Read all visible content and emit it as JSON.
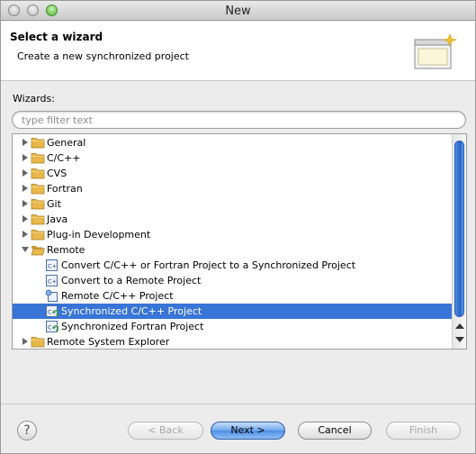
{
  "window": {
    "title": "New"
  },
  "banner": {
    "title": "Select a wizard",
    "description": "Create a new synchronized project"
  },
  "wizards_label": "Wizards:",
  "filter": {
    "placeholder": "type filter text",
    "value": ""
  },
  "tree": {
    "items": [
      {
        "label": "General",
        "kind": "folder",
        "expanded": false,
        "selected": false
      },
      {
        "label": "C/C++",
        "kind": "folder",
        "expanded": false,
        "selected": false
      },
      {
        "label": "CVS",
        "kind": "folder",
        "expanded": false,
        "selected": false
      },
      {
        "label": "Fortran",
        "kind": "folder",
        "expanded": false,
        "selected": false
      },
      {
        "label": "Git",
        "kind": "folder",
        "expanded": false,
        "selected": false
      },
      {
        "label": "Java",
        "kind": "folder",
        "expanded": false,
        "selected": false
      },
      {
        "label": "Plug-in Development",
        "kind": "folder",
        "expanded": false,
        "selected": false
      },
      {
        "label": "Remote",
        "kind": "folder",
        "expanded": true,
        "selected": false
      },
      {
        "label": "Convert C/C++ or Fortran Project to a Synchronized Project",
        "kind": "wizard",
        "icon": "cpp-convert-icon",
        "selected": false
      },
      {
        "label": "Convert to a Remote Project",
        "kind": "wizard",
        "icon": "cpp-convert-icon",
        "selected": false
      },
      {
        "label": "Remote C/C++ Project",
        "kind": "wizard",
        "icon": "remote-project-icon",
        "selected": false
      },
      {
        "label": "Synchronized C/C++ Project",
        "kind": "wizard",
        "icon": "sync-project-icon",
        "selected": true
      },
      {
        "label": "Synchronized Fortran Project",
        "kind": "wizard",
        "icon": "sync-project-icon",
        "selected": false
      },
      {
        "label": "Remote System Explorer",
        "kind": "folder",
        "expanded": false,
        "selected": false
      }
    ]
  },
  "buttons": {
    "help": "?",
    "back": "< Back",
    "next": "Next >",
    "cancel": "Cancel",
    "finish": "Finish"
  },
  "colors": {
    "selection": "#3875d7",
    "primary_button": "#4d8ee6",
    "folder": "#e8b84a"
  }
}
